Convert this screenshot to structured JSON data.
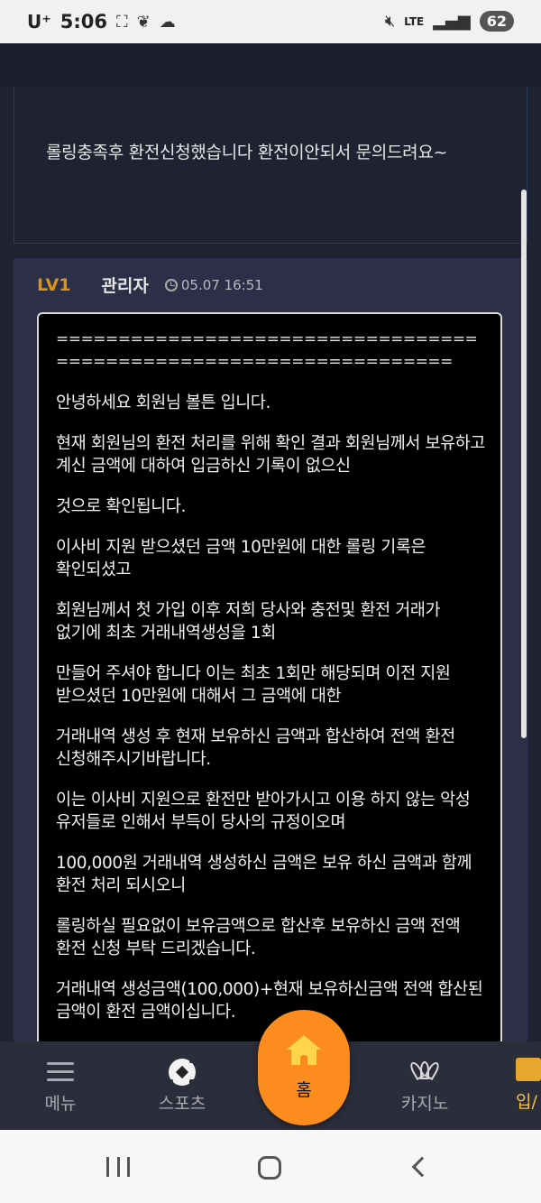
{
  "status_bar": {
    "carrier": "U⁺",
    "time": "5:06",
    "network": "LTE",
    "battery": "62"
  },
  "question": {
    "text": "롤링충족후 환전신청했습니다 환전이안되서 문의드려요~"
  },
  "reply": {
    "level": "LV1",
    "author": "관리자",
    "date": "05.07 16:51",
    "divider": "==================================================================",
    "paragraphs": [
      "안녕하세요 회원님 볼튼 입니다.",
      "현재 회원님의 환전 처리를 위해 확인 결과 회원님께서 보유하고 계신 금액에 대하여 입금하신 기록이 없으신",
      "것으로 확인됩니다.",
      "이사비 지원 받으셨던 금액 10만원에 대한 롤링 기록은 확인되셨고",
      "회원님께서 첫 가입 이후 저희 당사와 충전및 환전 거래가 없기에 최초 거래내역생성을 1회",
      "만들어 주셔야 합니다 이는 최초 1회만 해당되며 이전 지원 받으셨던 10만원에 대해서 그 금액에 대한",
      "거래내역 생성 후 현재 보유하신 금액과 합산하여 전액 환전 신청해주시기바랍니다.",
      "이는 이사비 지원으로 환전만 받아가시고 이용 하지 않는 악성 유저들로 인해서 부득이 당사의 규정이오며",
      "100,000원 거래내역 생성하신 금액은 보유 하신 금액과 함께 환전 처리 되시오니",
      "롤링하실 필요없이 보유금액으로 합산후 보유하신 금액 전액 환전 신청 부탁 드리겠습니다.",
      "거래내역 생성금액(100,000)+현재 보유하신금액 전액 합산된 금액이 환전 금액이십니다."
    ]
  },
  "bottom_nav": {
    "menu": "메뉴",
    "sports": "스포츠",
    "home": "홈",
    "casino": "카지노",
    "deposit_partial": "입/"
  },
  "icons": {
    "menu": "hamburger-icon",
    "sports": "soccer-ball-icon",
    "home": "house-icon",
    "casino": "lotus-logo-icon",
    "deposit": "wallet-icon"
  },
  "colors": {
    "app_bg": "#1e2231",
    "reply_card_bg": "#2d2f48",
    "level_color": "#d8951d",
    "home_button": "#fb8c1d",
    "nav_bg": "#2b2d3a"
  }
}
